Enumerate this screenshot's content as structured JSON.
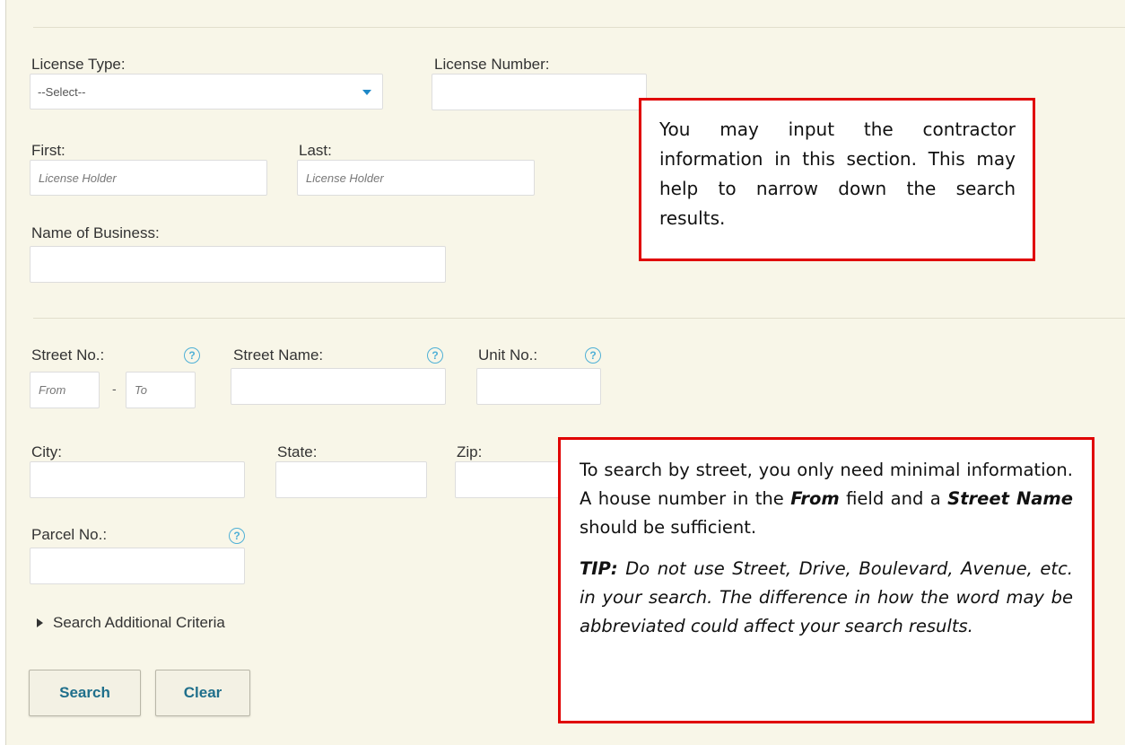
{
  "form": {
    "license_type_label": "License Type:",
    "license_type_value": "--Select--",
    "license_number_label": "License Number:",
    "license_number_value": "",
    "first_label": "First:",
    "first_placeholder": "License Holder",
    "last_label": "Last:",
    "last_placeholder": "License Holder",
    "business_label": "Name of Business:",
    "business_value": "",
    "street_no_label": "Street No.:",
    "street_from_placeholder": "From",
    "street_dash": "-",
    "street_to_placeholder": "To",
    "street_name_label": "Street Name:",
    "unit_no_label": "Unit No.:",
    "city_label": "City:",
    "state_label": "State:",
    "zip_label": "Zip:",
    "parcel_label": "Parcel No.:",
    "help_glyph": "?",
    "additional_criteria": "Search Additional Criteria",
    "search_button": "Search",
    "clear_button": "Clear"
  },
  "callout1": {
    "text": "You may input the contractor information in this section. This may help to narrow down the search results."
  },
  "callout2": {
    "p1_a": "To search by street, you only need minimal information. A house number in the ",
    "p1_from": "From",
    "p1_b": " field and a ",
    "p1_street": "Street Name",
    "p1_c": " should be sufficient.",
    "tip_label": "TIP:",
    "tip_text": " Do not use Street, Drive, Boulevard, Avenue, etc. in your search. The difference in how the word may be abbreviated could affect your search results."
  },
  "colors": {
    "panel_bg": "#f8f6e8",
    "callout_border": "#e00000",
    "help_icon": "#4fb0d6",
    "button_text": "#1f6f8b",
    "caret": "#1e88c7"
  },
  "icons": {
    "help": "question-circle-icon",
    "dropdown": "caret-down-icon",
    "expand": "triangle-right-icon"
  }
}
